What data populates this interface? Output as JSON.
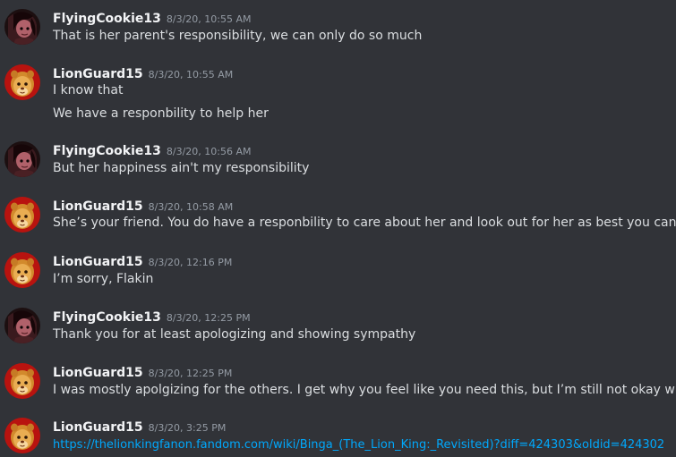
{
  "messages": [
    {
      "username": "FlyingCookie13",
      "avatar": "flyingcookie-avatar",
      "timestamp": "8/3/20, 10:55 AM",
      "lines": [
        "That is her parent's responsibility, we can only do so much"
      ]
    },
    {
      "username": "LionGuard15",
      "avatar": "lionguard-avatar",
      "timestamp": "8/3/20, 10:55 AM",
      "lines": [
        "I know that",
        "We have a responbility to help her"
      ]
    },
    {
      "username": "FlyingCookie13",
      "avatar": "flyingcookie-avatar",
      "timestamp": "8/3/20, 10:56 AM",
      "lines": [
        "But her happiness ain't my responsibility"
      ]
    },
    {
      "username": "LionGuard15",
      "avatar": "lionguard-avatar",
      "timestamp": "8/3/20, 10:58 AM",
      "lines": [
        "She’s your friend. You do have a responbility to care about her and look out for her as best you can"
      ]
    },
    {
      "username": "LionGuard15",
      "avatar": "lionguard-avatar",
      "timestamp": "8/3/20, 12:16 PM",
      "lines": [
        "I’m sorry, Flakin"
      ]
    },
    {
      "username": "FlyingCookie13",
      "avatar": "flyingcookie-avatar",
      "timestamp": "8/3/20, 12:25 PM",
      "lines": [
        "Thank you for at least apologizing and showing sympathy"
      ]
    },
    {
      "username": "LionGuard15",
      "avatar": "lionguard-avatar",
      "timestamp": "8/3/20, 12:25 PM",
      "lines": [
        "I was mostly apolgizing for the others. I get why you feel like you need this, but I’m still not okay with it"
      ]
    },
    {
      "username": "LionGuard15",
      "avatar": "lionguard-avatar",
      "timestamp": "8/3/20, 3:25 PM",
      "link": "https://thelionkingfanon.fandom.com/wiki/Binga_(The_Lion_King:_Revisited)?diff=424303&oldid=424302"
    }
  ],
  "colors": {
    "background": "#313338",
    "username": "#f2f3f5",
    "timestamp": "#949ba4",
    "text": "#dbdee1",
    "link": "#00a8fc"
  }
}
